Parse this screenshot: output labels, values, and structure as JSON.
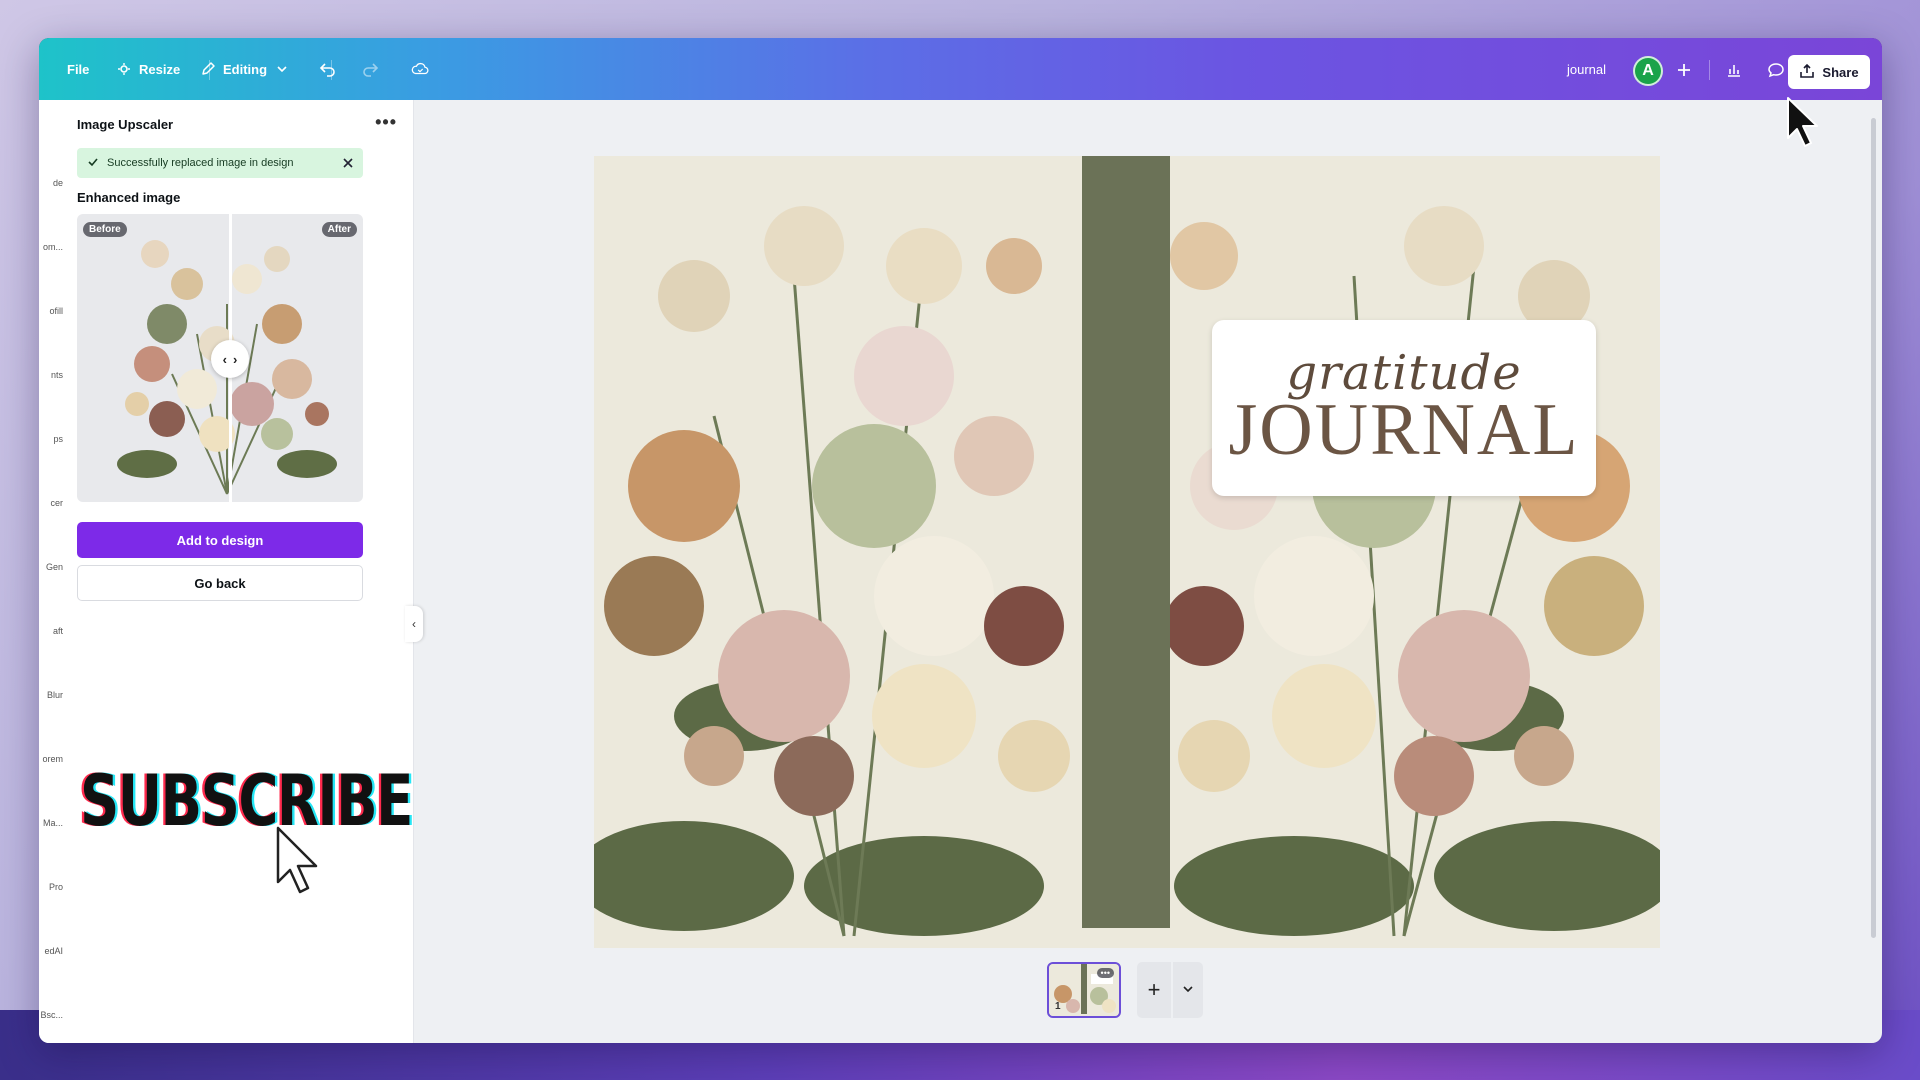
{
  "topbar": {
    "file_label": "File",
    "resize_label": "Resize",
    "editing_label": "Editing",
    "doc_title": "journal",
    "avatar_initial": "A",
    "share_label": "Share"
  },
  "rail": {
    "labels": [
      "de",
      "om...",
      "ofill",
      "nts",
      "ps",
      "cer",
      "Gen",
      "aft",
      "Blur",
      "orem",
      "Ma...",
      "Pro",
      "edAI",
      "Bsc..."
    ]
  },
  "panel": {
    "title": "Image Upscaler",
    "menu_label": "•••",
    "toast_text": "Successfully replaced image in design",
    "enhanced_label": "Enhanced image",
    "before_label": "Before",
    "after_label": "After",
    "add_button": "Add to design",
    "back_button": "Go back"
  },
  "overlay": {
    "subscribe_text": "SUBSCRIBE"
  },
  "cover": {
    "title_script": "gratitude",
    "title_main": "JOURNAL"
  },
  "pages": {
    "thumb_number": "1",
    "thumb_menu": "•••",
    "add_label": "+"
  },
  "colors": {
    "accent_purple": "#7d2ae8",
    "toast_green": "#d8f5df",
    "spine": "#6b7257",
    "cover_bg": "#ece9dc",
    "title_brown": "#6b5544"
  },
  "icons": [
    "upload-icon",
    "undo-icon",
    "redo-icon",
    "cloud-sync-icon",
    "pencil-icon",
    "chevron-down-icon",
    "plus-icon",
    "analytics-icon",
    "comment-icon",
    "check-icon",
    "close-icon",
    "chevron-left-icon"
  ]
}
